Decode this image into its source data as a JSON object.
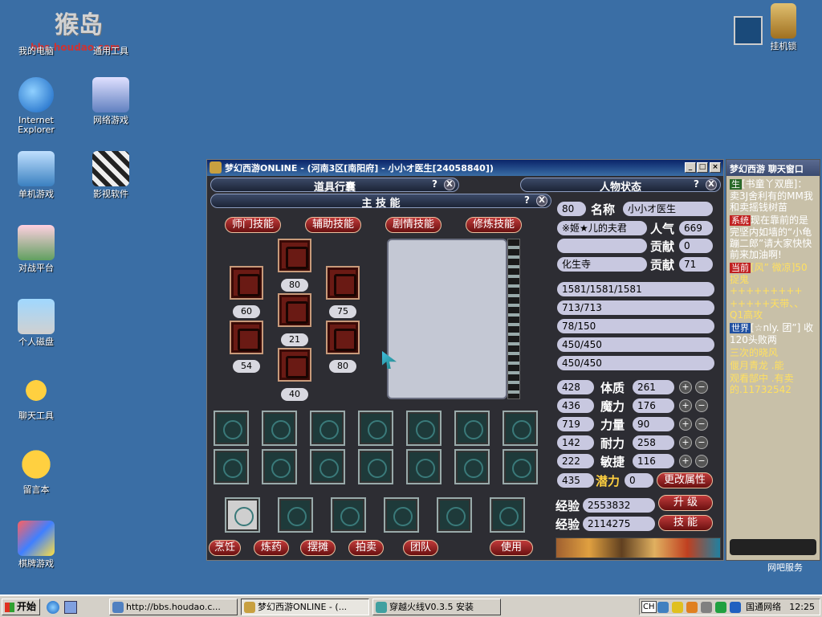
{
  "watermark": {
    "text": "猴岛",
    "url": "bbs.houdao.com"
  },
  "desktop_icons": [
    {
      "label": "我的电脑"
    },
    {
      "label": "通用工具"
    },
    {
      "label": "Internet Explorer"
    },
    {
      "label": "网络游戏"
    },
    {
      "label": "单机游戏"
    },
    {
      "label": "影视软件"
    },
    {
      "label": "对战平台"
    },
    {
      "label": "个人磁盘"
    },
    {
      "label": "聊天工具"
    },
    {
      "label": "留言本"
    },
    {
      "label": "棋牌游戏"
    },
    {
      "label": "挂机锁"
    }
  ],
  "game_window": {
    "title": "梦幻西游ONLINE - (河南3区[南阳府] - 小小オ医生[24058840])",
    "item_panel_title": "道具行囊",
    "char_panel_title": "人物状态",
    "skill_panel_title": "主 技 能",
    "help": "?",
    "close": "X",
    "skill_tabs": [
      "师门技能",
      "辅助技能",
      "剧情技能",
      "修炼技能"
    ],
    "skill_levels": [
      "80",
      "60",
      "75",
      "21",
      "54",
      "80",
      "40"
    ],
    "bottom_buttons": [
      "烹饪",
      "炼药",
      "摆摊",
      "拍卖",
      "团队",
      "使用"
    ],
    "character": {
      "level": "80",
      "name_label": "名称",
      "name": "小小オ医生",
      "title": "※姬★儿的夫君",
      "popularity_label": "人气",
      "popularity": "669",
      "contribution_label": "贡献",
      "contribution_1": "0",
      "sect": "化生寺",
      "contribution_2": "71",
      "hp": "1581/1581/1581",
      "mp": "713/713",
      "anger": "78/150",
      "vitality": "450/450",
      "energy": "450/450",
      "stats": [
        {
          "left": "428",
          "label": "体质",
          "value": "261"
        },
        {
          "left": "436",
          "label": "魔力",
          "value": "176"
        },
        {
          "left": "719",
          "label": "力量",
          "value": "90"
        },
        {
          "left": "142",
          "label": "耐力",
          "value": "258"
        },
        {
          "left": "222",
          "label": "敏捷",
          "value": "116"
        }
      ],
      "potential_left": "435",
      "potential_label": "潜力",
      "potential": "0",
      "change_attr": "更改属性",
      "exp_label_1": "经验",
      "exp_1": "2553832",
      "exp_label_2": "经验",
      "exp_2": "2114275",
      "level_up": "升 级",
      "skills_btn": "技 能"
    }
  },
  "chat_window": {
    "title": "梦幻西游  聊天窗口",
    "messages": [
      {
        "tag": "生",
        "text": "[书童丫双鹿]：卖3J舍利有的MM我和卖摇钱树苗"
      },
      {
        "tag": "系统",
        "text": "现在靠前的是完坚内如墙的“小龟蹦二郎”请大家快快前来加油啊!"
      },
      {
        "tag": "当前",
        "text": "[风” 微凉]50捉鬼+++++++++"
      },
      {
        "tag": "",
        "text": "+++++天带、、Q1高攻"
      },
      {
        "tag": "世界",
        "text": "[☆nly. 团”] 收120头败两"
      },
      {
        "tag": "",
        "text": "三次的晓风"
      },
      {
        "tag": "",
        "text": "偃月青龙 .能"
      },
      {
        "tag": "",
        "text": "观看郜中 .有卖的.11732542"
      }
    ],
    "footer_text": "网吧服务"
  },
  "taskbar": {
    "start": "开始",
    "tasks": [
      {
        "label": "http://bbs.houdao.c..."
      },
      {
        "label": "梦幻西游ONLINE - (..."
      },
      {
        "label": "穿越火线V0.3.5 安装"
      }
    ],
    "tray_ime": "CH",
    "tray_network": "国通网络",
    "clock": "12:25"
  }
}
